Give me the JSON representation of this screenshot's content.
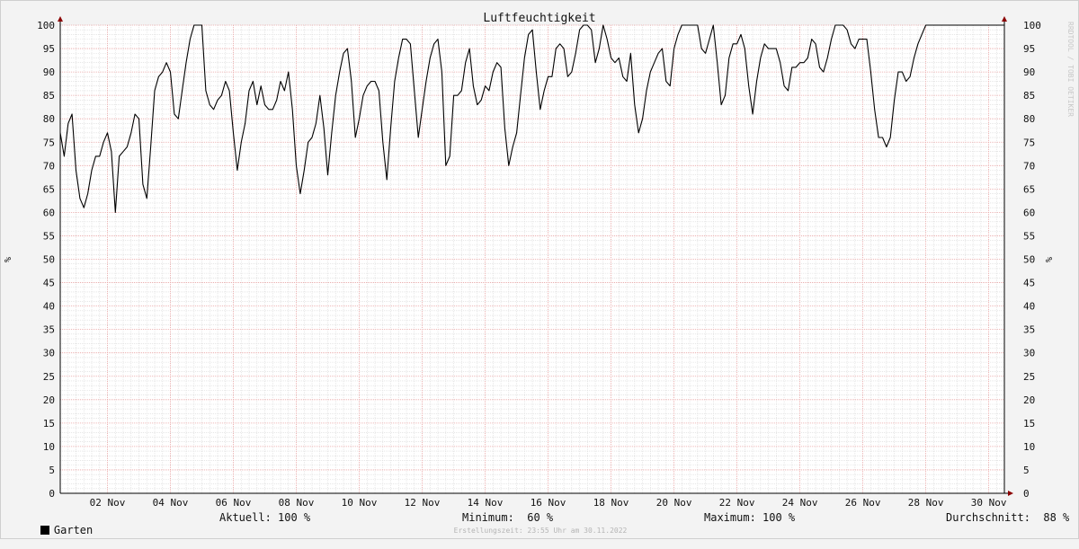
{
  "chart_data": {
    "type": "line",
    "title": "Luftfeuchtigkeit",
    "ylabel": "%",
    "ylim": [
      0,
      100
    ],
    "yticks": [
      0,
      5,
      10,
      15,
      20,
      25,
      30,
      35,
      40,
      45,
      50,
      55,
      60,
      65,
      70,
      75,
      80,
      85,
      90,
      95,
      100
    ],
    "xlim": [
      "2022-11-01T00:00",
      "2022-11-30T23:55"
    ],
    "xticks": [
      {
        "date": "2022-11-02T12:00",
        "label": "02 Nov"
      },
      {
        "date": "2022-11-04T12:00",
        "label": "04 Nov"
      },
      {
        "date": "2022-11-06T12:00",
        "label": "06 Nov"
      },
      {
        "date": "2022-11-08T12:00",
        "label": "08 Nov"
      },
      {
        "date": "2022-11-10T12:00",
        "label": "10 Nov"
      },
      {
        "date": "2022-11-12T12:00",
        "label": "12 Nov"
      },
      {
        "date": "2022-11-14T12:00",
        "label": "14 Nov"
      },
      {
        "date": "2022-11-16T12:00",
        "label": "16 Nov"
      },
      {
        "date": "2022-11-18T12:00",
        "label": "18 Nov"
      },
      {
        "date": "2022-11-20T12:00",
        "label": "20 Nov"
      },
      {
        "date": "2022-11-22T12:00",
        "label": "22 Nov"
      },
      {
        "date": "2022-11-24T12:00",
        "label": "24 Nov"
      },
      {
        "date": "2022-11-26T12:00",
        "label": "26 Nov"
      },
      {
        "date": "2022-11-28T12:00",
        "label": "28 Nov"
      },
      {
        "date": "2022-11-30T12:00",
        "label": "30 Nov"
      }
    ],
    "grid": true,
    "series": [
      {
        "name": "Garten",
        "color": "#000000",
        "points": [
          [
            "2022-11-01T00:00",
            77
          ],
          [
            "2022-11-01T03:00",
            72
          ],
          [
            "2022-11-01T06:00",
            79
          ],
          [
            "2022-11-01T09:00",
            81
          ],
          [
            "2022-11-01T12:00",
            69
          ],
          [
            "2022-11-01T15:00",
            63
          ],
          [
            "2022-11-01T18:00",
            61
          ],
          [
            "2022-11-01T21:00",
            64
          ],
          [
            "2022-11-02T00:00",
            69
          ],
          [
            "2022-11-02T03:00",
            72
          ],
          [
            "2022-11-02T06:00",
            72
          ],
          [
            "2022-11-02T09:00",
            75
          ],
          [
            "2022-11-02T12:00",
            77
          ],
          [
            "2022-11-02T15:00",
            73
          ],
          [
            "2022-11-02T18:00",
            60
          ],
          [
            "2022-11-02T21:00",
            72
          ],
          [
            "2022-11-03T00:00",
            73
          ],
          [
            "2022-11-03T03:00",
            74
          ],
          [
            "2022-11-03T06:00",
            77
          ],
          [
            "2022-11-03T09:00",
            81
          ],
          [
            "2022-11-03T12:00",
            80
          ],
          [
            "2022-11-03T15:00",
            66
          ],
          [
            "2022-11-03T18:00",
            63
          ],
          [
            "2022-11-03T21:00",
            74
          ],
          [
            "2022-11-04T00:00",
            86
          ],
          [
            "2022-11-04T03:00",
            89
          ],
          [
            "2022-11-04T06:00",
            90
          ],
          [
            "2022-11-04T09:00",
            92
          ],
          [
            "2022-11-04T12:00",
            90
          ],
          [
            "2022-11-04T15:00",
            81
          ],
          [
            "2022-11-04T18:00",
            80
          ],
          [
            "2022-11-04T21:00",
            86
          ],
          [
            "2022-11-05T00:00",
            92
          ],
          [
            "2022-11-05T03:00",
            97
          ],
          [
            "2022-11-05T06:00",
            100
          ],
          [
            "2022-11-05T09:00",
            100
          ],
          [
            "2022-11-05T12:00",
            100
          ],
          [
            "2022-11-05T15:00",
            86
          ],
          [
            "2022-11-05T18:00",
            83
          ],
          [
            "2022-11-05T21:00",
            82
          ],
          [
            "2022-11-06T00:00",
            84
          ],
          [
            "2022-11-06T03:00",
            85
          ],
          [
            "2022-11-06T06:00",
            88
          ],
          [
            "2022-11-06T09:00",
            86
          ],
          [
            "2022-11-06T12:00",
            77
          ],
          [
            "2022-11-06T15:00",
            69
          ],
          [
            "2022-11-06T18:00",
            75
          ],
          [
            "2022-11-06T21:00",
            79
          ],
          [
            "2022-11-07T00:00",
            86
          ],
          [
            "2022-11-07T03:00",
            88
          ],
          [
            "2022-11-07T06:00",
            83
          ],
          [
            "2022-11-07T09:00",
            87
          ],
          [
            "2022-11-07T12:00",
            83
          ],
          [
            "2022-11-07T15:00",
            82
          ],
          [
            "2022-11-07T18:00",
            82
          ],
          [
            "2022-11-07T21:00",
            84
          ],
          [
            "2022-11-08T00:00",
            88
          ],
          [
            "2022-11-08T03:00",
            86
          ],
          [
            "2022-11-08T06:00",
            90
          ],
          [
            "2022-11-08T09:00",
            82
          ],
          [
            "2022-11-08T12:00",
            70
          ],
          [
            "2022-11-08T15:00",
            64
          ],
          [
            "2022-11-08T18:00",
            69
          ],
          [
            "2022-11-08T21:00",
            75
          ],
          [
            "2022-11-09T00:00",
            76
          ],
          [
            "2022-11-09T03:00",
            79
          ],
          [
            "2022-11-09T06:00",
            85
          ],
          [
            "2022-11-09T09:00",
            78
          ],
          [
            "2022-11-09T12:00",
            68
          ],
          [
            "2022-11-09T15:00",
            77
          ],
          [
            "2022-11-09T18:00",
            85
          ],
          [
            "2022-11-09T21:00",
            90
          ],
          [
            "2022-11-10T00:00",
            94
          ],
          [
            "2022-11-10T03:00",
            95
          ],
          [
            "2022-11-10T06:00",
            88
          ],
          [
            "2022-11-10T09:00",
            76
          ],
          [
            "2022-11-10T12:00",
            80
          ],
          [
            "2022-11-10T15:00",
            85
          ],
          [
            "2022-11-10T18:00",
            87
          ],
          [
            "2022-11-10T21:00",
            88
          ],
          [
            "2022-11-11T00:00",
            88
          ],
          [
            "2022-11-11T03:00",
            86
          ],
          [
            "2022-11-11T06:00",
            75
          ],
          [
            "2022-11-11T09:00",
            67
          ],
          [
            "2022-11-11T12:00",
            78
          ],
          [
            "2022-11-11T15:00",
            88
          ],
          [
            "2022-11-11T18:00",
            93
          ],
          [
            "2022-11-11T21:00",
            97
          ],
          [
            "2022-11-12T00:00",
            97
          ],
          [
            "2022-11-12T03:00",
            96
          ],
          [
            "2022-11-12T06:00",
            86
          ],
          [
            "2022-11-12T09:00",
            76
          ],
          [
            "2022-11-12T12:00",
            82
          ],
          [
            "2022-11-12T15:00",
            88
          ],
          [
            "2022-11-12T18:00",
            93
          ],
          [
            "2022-11-12T21:00",
            96
          ],
          [
            "2022-11-13T00:00",
            97
          ],
          [
            "2022-11-13T03:00",
            90
          ],
          [
            "2022-11-13T06:00",
            70
          ],
          [
            "2022-11-13T09:00",
            72
          ],
          [
            "2022-11-13T12:00",
            85
          ],
          [
            "2022-11-13T15:00",
            85
          ],
          [
            "2022-11-13T18:00",
            86
          ],
          [
            "2022-11-13T21:00",
            92
          ],
          [
            "2022-11-14T00:00",
            95
          ],
          [
            "2022-11-14T03:00",
            87
          ],
          [
            "2022-11-14T06:00",
            83
          ],
          [
            "2022-11-14T09:00",
            84
          ],
          [
            "2022-11-14T12:00",
            87
          ],
          [
            "2022-11-14T15:00",
            86
          ],
          [
            "2022-11-14T18:00",
            90
          ],
          [
            "2022-11-14T21:00",
            92
          ],
          [
            "2022-11-15T00:00",
            91
          ],
          [
            "2022-11-15T03:00",
            78
          ],
          [
            "2022-11-15T06:00",
            70
          ],
          [
            "2022-11-15T09:00",
            74
          ],
          [
            "2022-11-15T12:00",
            77
          ],
          [
            "2022-11-15T15:00",
            85
          ],
          [
            "2022-11-15T18:00",
            93
          ],
          [
            "2022-11-15T21:00",
            98
          ],
          [
            "2022-11-16T00:00",
            99
          ],
          [
            "2022-11-16T03:00",
            90
          ],
          [
            "2022-11-16T06:00",
            82
          ],
          [
            "2022-11-16T09:00",
            86
          ],
          [
            "2022-11-16T12:00",
            89
          ],
          [
            "2022-11-16T15:00",
            89
          ],
          [
            "2022-11-16T18:00",
            95
          ],
          [
            "2022-11-16T21:00",
            96
          ],
          [
            "2022-11-17T00:00",
            95
          ],
          [
            "2022-11-17T03:00",
            89
          ],
          [
            "2022-11-17T06:00",
            90
          ],
          [
            "2022-11-17T09:00",
            94
          ],
          [
            "2022-11-17T12:00",
            99
          ],
          [
            "2022-11-17T15:00",
            100
          ],
          [
            "2022-11-17T18:00",
            100
          ],
          [
            "2022-11-17T21:00",
            99
          ],
          [
            "2022-11-18T00:00",
            92
          ],
          [
            "2022-11-18T03:00",
            95
          ],
          [
            "2022-11-18T06:00",
            100
          ],
          [
            "2022-11-18T09:00",
            97
          ],
          [
            "2022-11-18T12:00",
            93
          ],
          [
            "2022-11-18T15:00",
            92
          ],
          [
            "2022-11-18T18:00",
            93
          ],
          [
            "2022-11-18T21:00",
            89
          ],
          [
            "2022-11-19T00:00",
            88
          ],
          [
            "2022-11-19T03:00",
            94
          ],
          [
            "2022-11-19T06:00",
            83
          ],
          [
            "2022-11-19T09:00",
            77
          ],
          [
            "2022-11-19T12:00",
            80
          ],
          [
            "2022-11-19T15:00",
            86
          ],
          [
            "2022-11-19T18:00",
            90
          ],
          [
            "2022-11-19T21:00",
            92
          ],
          [
            "2022-11-20T00:00",
            94
          ],
          [
            "2022-11-20T03:00",
            95
          ],
          [
            "2022-11-20T06:00",
            88
          ],
          [
            "2022-11-20T09:00",
            87
          ],
          [
            "2022-11-20T12:00",
            95
          ],
          [
            "2022-11-20T15:00",
            98
          ],
          [
            "2022-11-20T18:00",
            100
          ],
          [
            "2022-11-20T21:00",
            100
          ],
          [
            "2022-11-21T00:00",
            100
          ],
          [
            "2022-11-21T03:00",
            100
          ],
          [
            "2022-11-21T06:00",
            100
          ],
          [
            "2022-11-21T09:00",
            95
          ],
          [
            "2022-11-21T12:00",
            94
          ],
          [
            "2022-11-21T15:00",
            97
          ],
          [
            "2022-11-21T18:00",
            100
          ],
          [
            "2022-11-21T21:00",
            92
          ],
          [
            "2022-11-22T00:00",
            83
          ],
          [
            "2022-11-22T03:00",
            85
          ],
          [
            "2022-11-22T06:00",
            93
          ],
          [
            "2022-11-22T09:00",
            96
          ],
          [
            "2022-11-22T12:00",
            96
          ],
          [
            "2022-11-22T15:00",
            98
          ],
          [
            "2022-11-22T18:00",
            95
          ],
          [
            "2022-11-22T21:00",
            87
          ],
          [
            "2022-11-23T00:00",
            81
          ],
          [
            "2022-11-23T03:00",
            88
          ],
          [
            "2022-11-23T06:00",
            93
          ],
          [
            "2022-11-23T09:00",
            96
          ],
          [
            "2022-11-23T12:00",
            95
          ],
          [
            "2022-11-23T15:00",
            95
          ],
          [
            "2022-11-23T18:00",
            95
          ],
          [
            "2022-11-23T21:00",
            92
          ],
          [
            "2022-11-24T00:00",
            87
          ],
          [
            "2022-11-24T03:00",
            86
          ],
          [
            "2022-11-24T06:00",
            91
          ],
          [
            "2022-11-24T09:00",
            91
          ],
          [
            "2022-11-24T12:00",
            92
          ],
          [
            "2022-11-24T15:00",
            92
          ],
          [
            "2022-11-24T18:00",
            93
          ],
          [
            "2022-11-24T21:00",
            97
          ],
          [
            "2022-11-25T00:00",
            96
          ],
          [
            "2022-11-25T03:00",
            91
          ],
          [
            "2022-11-25T06:00",
            90
          ],
          [
            "2022-11-25T09:00",
            93
          ],
          [
            "2022-11-25T12:00",
            97
          ],
          [
            "2022-11-25T15:00",
            100
          ],
          [
            "2022-11-25T18:00",
            100
          ],
          [
            "2022-11-25T21:00",
            100
          ],
          [
            "2022-11-26T00:00",
            99
          ],
          [
            "2022-11-26T03:00",
            96
          ],
          [
            "2022-11-26T06:00",
            95
          ],
          [
            "2022-11-26T09:00",
            97
          ],
          [
            "2022-11-26T12:00",
            97
          ],
          [
            "2022-11-26T15:00",
            97
          ],
          [
            "2022-11-26T18:00",
            90
          ],
          [
            "2022-11-26T21:00",
            82
          ],
          [
            "2022-11-27T00:00",
            76
          ],
          [
            "2022-11-27T03:00",
            76
          ],
          [
            "2022-11-27T06:00",
            74
          ],
          [
            "2022-11-27T09:00",
            76
          ],
          [
            "2022-11-27T12:00",
            84
          ],
          [
            "2022-11-27T15:00",
            90
          ],
          [
            "2022-11-27T18:00",
            90
          ],
          [
            "2022-11-27T21:00",
            88
          ],
          [
            "2022-11-28T00:00",
            89
          ],
          [
            "2022-11-28T03:00",
            93
          ],
          [
            "2022-11-28T06:00",
            96
          ],
          [
            "2022-11-28T09:00",
            98
          ],
          [
            "2022-11-28T12:00",
            100
          ],
          [
            "2022-11-28T18:00",
            100
          ],
          [
            "2022-11-29T00:00",
            100
          ],
          [
            "2022-11-29T12:00",
            100
          ],
          [
            "2022-11-30T00:00",
            100
          ],
          [
            "2022-11-30T12:00",
            100
          ],
          [
            "2022-11-30T23:55",
            100
          ]
        ]
      }
    ],
    "colors": {
      "background": "#ffffff",
      "major_grid": "#e8a0a0",
      "minor_grid": "#d8d8d8",
      "axis": "#000000",
      "arrow": "#8b0000",
      "line": "#000000"
    }
  },
  "legend": {
    "series_label": "Garten",
    "current": "Aktuell: 100 %",
    "minimum": "Minimum:  60 %",
    "maximum": "Maximum: 100 %",
    "average": "Durchschnitt:  88 %"
  },
  "footer": "Erstellungszeit: 23:55 Uhr am 30.11.2022",
  "watermark": "RRDTOOL / TOBI OETIKER"
}
